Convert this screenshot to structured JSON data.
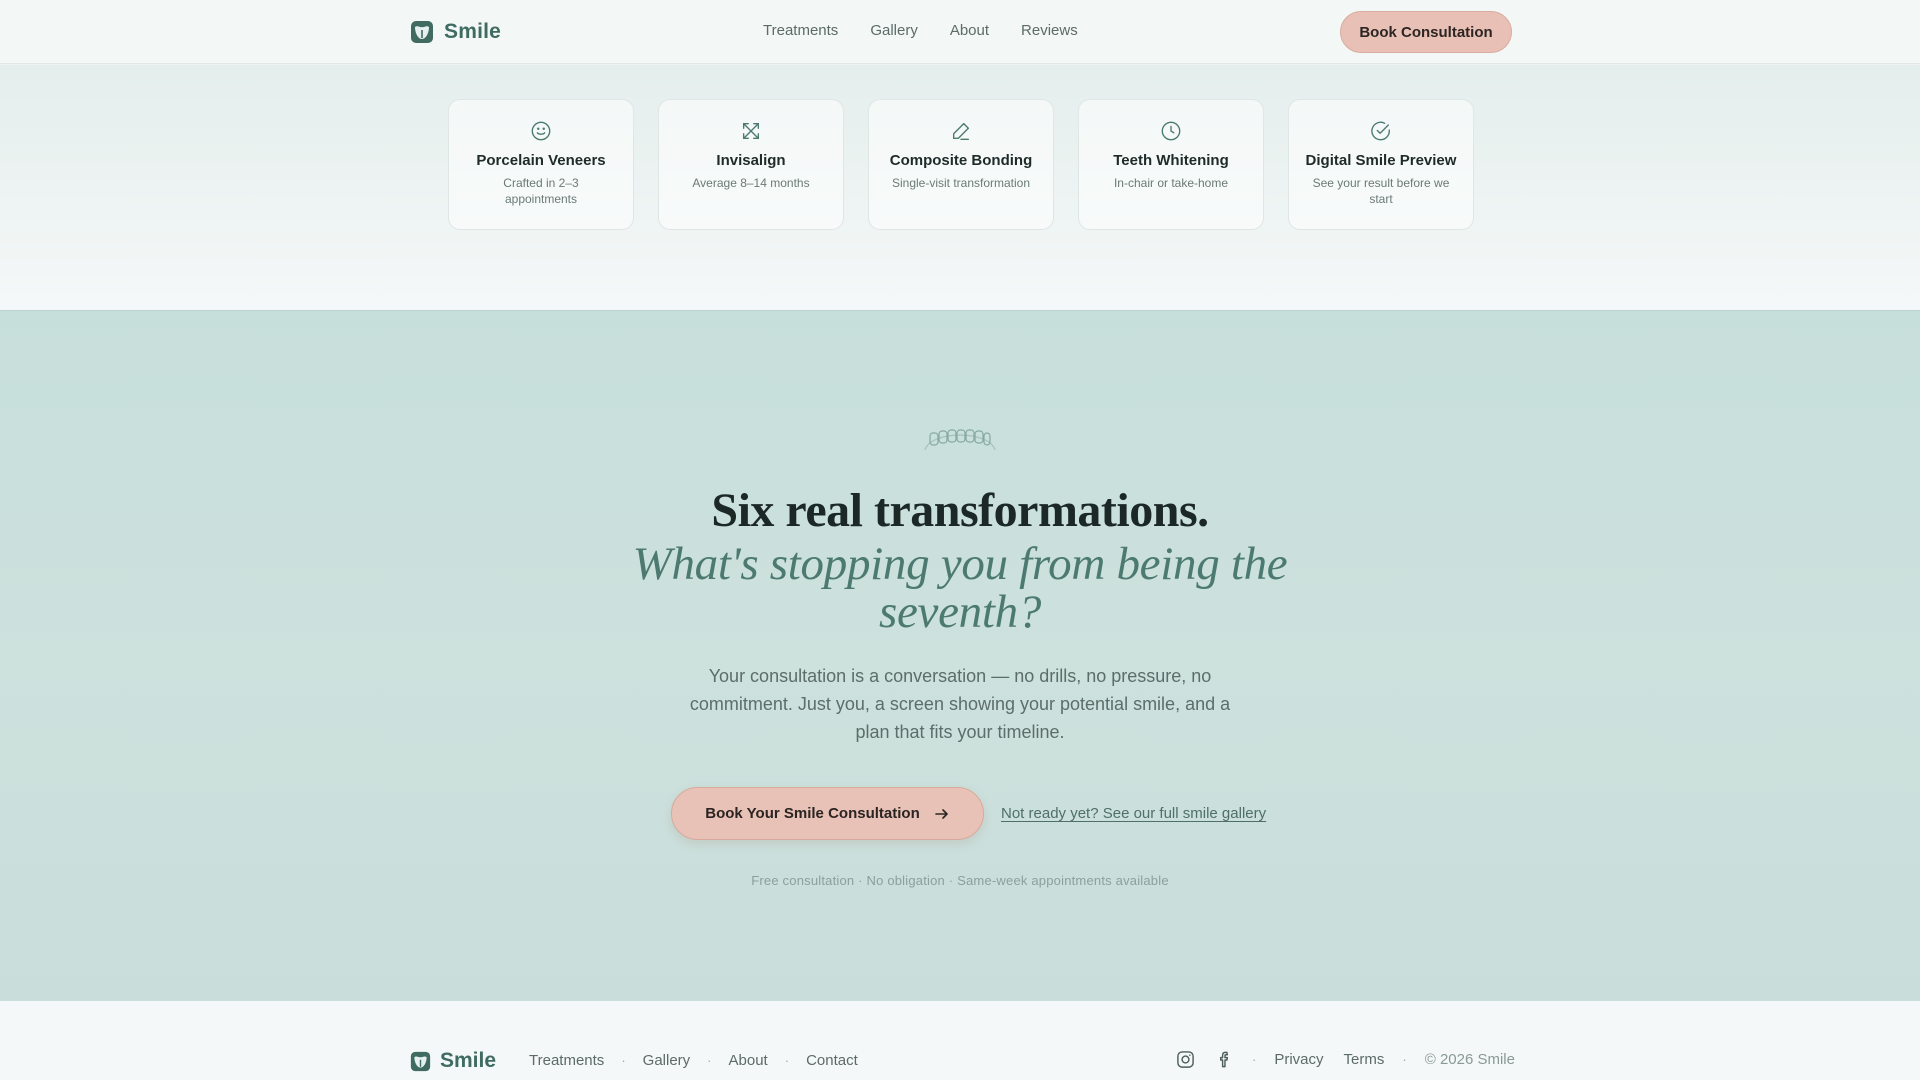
{
  "brand": {
    "name": "Smile",
    "accent": "#3f6b61",
    "cta_color": "#e8c2b7"
  },
  "header": {
    "nav": [
      "Treatments",
      "Gallery",
      "About",
      "Reviews"
    ],
    "cta_label": "Book Consultation"
  },
  "treatments": [
    {
      "icon": "smile-icon",
      "title": "Porcelain Veneers",
      "subtitle": "Crafted in 2–3 appointments"
    },
    {
      "icon": "expand-arrows-icon",
      "title": "Invisalign",
      "subtitle": "Average 8–14 months"
    },
    {
      "icon": "pen-icon",
      "title": "Composite Bonding",
      "subtitle": "Single-visit transformation"
    },
    {
      "icon": "clock-icon",
      "title": "Teeth Whitening",
      "subtitle": "In-chair or take-home"
    },
    {
      "icon": "check-circle-icon",
      "title": "Digital Smile Preview",
      "subtitle": "See your result before we start"
    }
  ],
  "cta": {
    "title": "Six real transformations.",
    "italic": "What's stopping you from being the seventh?",
    "body": "Your consultation is a conversation — no drills, no pressure, no commitment. Just you, a screen showing your potential smile, and a plan that fits your timeline.",
    "button_label": "Book Your Smile Consultation",
    "secondary_link": "Not ready yet? See our full smile gallery",
    "fineprint": "Free consultation · No obligation · Same-week appointments available"
  },
  "footer": {
    "brand": "Smile",
    "nav": [
      "Treatments",
      "Gallery",
      "About",
      "Contact"
    ],
    "social": [
      "instagram-icon",
      "facebook-icon"
    ],
    "legal": [
      "Privacy",
      "Terms"
    ],
    "copyright": "© 2026 Smile"
  }
}
